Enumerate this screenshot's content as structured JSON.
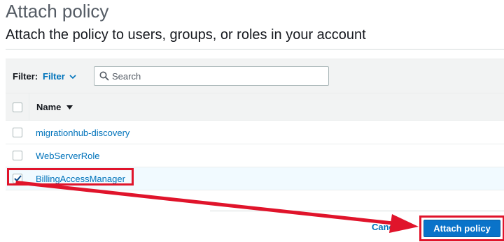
{
  "header": {
    "title": "Attach policy",
    "subtitle": "Attach the policy to users, groups, or roles in your account"
  },
  "filter": {
    "label": "Filter:",
    "dropdown_value": "Filter",
    "search_placeholder": "Search"
  },
  "table": {
    "column_name": "Name",
    "rows": [
      {
        "name": "migrationhub-discovery",
        "selected": false
      },
      {
        "name": "WebServerRole",
        "selected": false
      },
      {
        "name": "BillingAccessManager",
        "selected": true
      }
    ]
  },
  "footer": {
    "cancel_label": "Cancel",
    "attach_label": "Attach policy"
  },
  "colors": {
    "link": "#0073bb",
    "primary_button": "#0a73c9",
    "annotation": "#e0142b",
    "selected_row": "#f1faff"
  },
  "icons": [
    "search-icon",
    "chevron-down-icon",
    "sort-down-icon",
    "checkmark-icon",
    "annotation-arrow"
  ]
}
